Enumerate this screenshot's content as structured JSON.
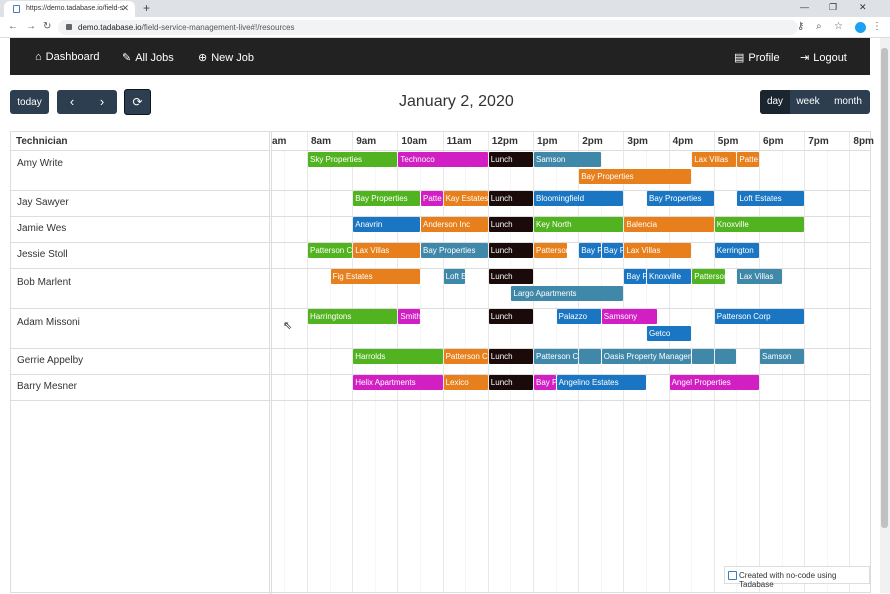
{
  "browser": {
    "tab_title": "https://demo.tadabase.io/field-s",
    "url_host": "demo.tadabase.io",
    "url_path": "/field-service-management-live#!/resources"
  },
  "nav": {
    "dashboard": "Dashboard",
    "all_jobs": "All Jobs",
    "new_job": "New Job",
    "profile": "Profile",
    "logout": "Logout"
  },
  "toolbar": {
    "today": "today",
    "title": "January 2, 2020",
    "views": [
      "day",
      "week",
      "month"
    ],
    "active_view": "day"
  },
  "calendar": {
    "resource_header": "Technician",
    "hours": [
      "am",
      "8am",
      "9am",
      "10am",
      "11am",
      "12pm",
      "1pm",
      "2pm",
      "3pm",
      "4pm",
      "5pm",
      "6pm",
      "7pm",
      "8pm"
    ],
    "technicians": [
      "Amy Write",
      "Jay Sawyer",
      "Jamie Wes",
      "Jessie Stoll",
      "Bob Marlent",
      "Adam Missoni",
      "Gerrie Appelby",
      "Barry Mesner"
    ],
    "events": [
      {
        "row": 0,
        "lane": 0,
        "start": 8.0,
        "end": 10.0,
        "label": "Sky Properties",
        "color": "#52b320"
      },
      {
        "row": 0,
        "lane": 0,
        "start": 10.0,
        "end": 12.0,
        "label": "Technoco",
        "color": "#d21fc4"
      },
      {
        "row": 0,
        "lane": 0,
        "start": 12.0,
        "end": 13.0,
        "label": "Lunch",
        "color": "#1a0a0a"
      },
      {
        "row": 0,
        "lane": 0,
        "start": 13.0,
        "end": 14.5,
        "label": "Samson",
        "color": "#3f88a9"
      },
      {
        "row": 0,
        "lane": 0,
        "start": 16.5,
        "end": 17.5,
        "label": "Lax Villas",
        "color": "#e67f1c"
      },
      {
        "row": 0,
        "lane": 0,
        "start": 17.5,
        "end": 18.0,
        "label": "Patte",
        "color": "#e67f1c"
      },
      {
        "row": 0,
        "lane": 1,
        "start": 14.0,
        "end": 16.5,
        "label": "Bay Properties",
        "color": "#e67f1c"
      },
      {
        "row": 1,
        "lane": 0,
        "start": 9.0,
        "end": 10.5,
        "label": "Bay Properties",
        "color": "#52b320"
      },
      {
        "row": 1,
        "lane": 0,
        "start": 10.5,
        "end": 11.0,
        "label": "Patte",
        "color": "#d21fc4"
      },
      {
        "row": 1,
        "lane": 0,
        "start": 11.0,
        "end": 12.0,
        "label": "Kay Estates",
        "color": "#e67f1c"
      },
      {
        "row": 1,
        "lane": 0,
        "start": 12.0,
        "end": 13.0,
        "label": "Lunch",
        "color": "#1a0a0a"
      },
      {
        "row": 1,
        "lane": 0,
        "start": 13.0,
        "end": 15.0,
        "label": "Bloomingfield",
        "color": "#1a76c2"
      },
      {
        "row": 1,
        "lane": 0,
        "start": 15.5,
        "end": 17.0,
        "label": "Bay Properties",
        "color": "#1a76c2"
      },
      {
        "row": 1,
        "lane": 0,
        "start": 17.5,
        "end": 19.0,
        "label": "Loft Estates",
        "color": "#1a76c2"
      },
      {
        "row": 2,
        "lane": 0,
        "start": 9.0,
        "end": 10.5,
        "label": "Anavrin",
        "color": "#1a76c2"
      },
      {
        "row": 2,
        "lane": 0,
        "start": 10.5,
        "end": 12.0,
        "label": "Anderson Inc",
        "color": "#e67f1c"
      },
      {
        "row": 2,
        "lane": 0,
        "start": 12.0,
        "end": 13.0,
        "label": "Lunch",
        "color": "#1a0a0a"
      },
      {
        "row": 2,
        "lane": 0,
        "start": 13.0,
        "end": 15.0,
        "label": "Key North",
        "color": "#52b320"
      },
      {
        "row": 2,
        "lane": 0,
        "start": 15.0,
        "end": 17.0,
        "label": "Balencia",
        "color": "#e67f1c"
      },
      {
        "row": 2,
        "lane": 0,
        "start": 17.0,
        "end": 19.0,
        "label": "Knoxville",
        "color": "#52b320"
      },
      {
        "row": 3,
        "lane": 0,
        "start": 8.0,
        "end": 9.0,
        "label": "Patterson Corp",
        "color": "#52b320"
      },
      {
        "row": 3,
        "lane": 0,
        "start": 9.0,
        "end": 10.5,
        "label": "Lax Villas",
        "color": "#e67f1c"
      },
      {
        "row": 3,
        "lane": 0,
        "start": 10.5,
        "end": 12.0,
        "label": "Bay Properties",
        "color": "#3f88a9"
      },
      {
        "row": 3,
        "lane": 0,
        "start": 12.0,
        "end": 13.0,
        "label": "Lunch",
        "color": "#1a0a0a"
      },
      {
        "row": 3,
        "lane": 0,
        "start": 13.0,
        "end": 13.75,
        "label": "Patterson",
        "color": "#e67f1c"
      },
      {
        "row": 3,
        "lane": 0,
        "start": 14.0,
        "end": 14.5,
        "label": "Bay Properties",
        "color": "#1a76c2"
      },
      {
        "row": 3,
        "lane": 0,
        "start": 14.5,
        "end": 15.0,
        "label": "Bay Properties",
        "color": "#1a76c2"
      },
      {
        "row": 3,
        "lane": 0,
        "start": 15.0,
        "end": 16.5,
        "label": "Lax Villas",
        "color": "#e67f1c"
      },
      {
        "row": 3,
        "lane": 0,
        "start": 17.0,
        "end": 18.0,
        "label": "Kerrington",
        "color": "#1a76c2"
      },
      {
        "row": 4,
        "lane": 0,
        "start": 8.5,
        "end": 10.5,
        "label": "Fig Estates",
        "color": "#e67f1c"
      },
      {
        "row": 4,
        "lane": 0,
        "start": 11.0,
        "end": 11.5,
        "label": "Loft Estates",
        "color": "#3f88a9"
      },
      {
        "row": 4,
        "lane": 0,
        "start": 12.0,
        "end": 13.0,
        "label": "Lunch",
        "color": "#1a0a0a"
      },
      {
        "row": 4,
        "lane": 0,
        "start": 15.0,
        "end": 15.5,
        "label": "Bay Properties",
        "color": "#1a76c2"
      },
      {
        "row": 4,
        "lane": 0,
        "start": 15.5,
        "end": 16.5,
        "label": "Knoxville",
        "color": "#1a76c2"
      },
      {
        "row": 4,
        "lane": 0,
        "start": 16.5,
        "end": 17.25,
        "label": "Patterson",
        "color": "#52b320"
      },
      {
        "row": 4,
        "lane": 0,
        "start": 17.5,
        "end": 18.5,
        "label": "Lax Villas",
        "color": "#3f88a9"
      },
      {
        "row": 4,
        "lane": 1,
        "start": 12.5,
        "end": 15.0,
        "label": "Largo Apartments",
        "color": "#3f88a9"
      },
      {
        "row": 5,
        "lane": 0,
        "start": 8.0,
        "end": 10.0,
        "label": "Harringtons",
        "color": "#52b320"
      },
      {
        "row": 5,
        "lane": 0,
        "start": 10.0,
        "end": 10.5,
        "label": "Smith",
        "color": "#d21fc4"
      },
      {
        "row": 5,
        "lane": 0,
        "start": 12.0,
        "end": 13.0,
        "label": "Lunch",
        "color": "#1a0a0a"
      },
      {
        "row": 5,
        "lane": 0,
        "start": 13.5,
        "end": 14.5,
        "label": "Palazzo",
        "color": "#1a76c2"
      },
      {
        "row": 5,
        "lane": 0,
        "start": 14.5,
        "end": 15.75,
        "label": "Samsony",
        "color": "#d21fc4"
      },
      {
        "row": 5,
        "lane": 0,
        "start": 17.0,
        "end": 19.0,
        "label": "Patterson Corp",
        "color": "#1a76c2"
      },
      {
        "row": 5,
        "lane": 1,
        "start": 15.5,
        "end": 16.5,
        "label": "Getco",
        "color": "#1a76c2"
      },
      {
        "row": 6,
        "lane": 0,
        "start": 9.0,
        "end": 11.0,
        "label": "Harrolds",
        "color": "#52b320"
      },
      {
        "row": 6,
        "lane": 0,
        "start": 11.0,
        "end": 12.0,
        "label": "Patterson Corp",
        "color": "#e67f1c"
      },
      {
        "row": 6,
        "lane": 0,
        "start": 12.0,
        "end": 13.0,
        "label": "Lunch",
        "color": "#1a0a0a"
      },
      {
        "row": 6,
        "lane": 0,
        "start": 13.0,
        "end": 14.0,
        "label": "Patterson Corp",
        "color": "#3f88a9"
      },
      {
        "row": 6,
        "lane": 0,
        "start": 14.0,
        "end": 14.5,
        "label": "",
        "color": "#3f88a9"
      },
      {
        "row": 6,
        "lane": 0,
        "start": 14.5,
        "end": 16.5,
        "label": "Oasis Property Management",
        "color": "#3f88a9"
      },
      {
        "row": 6,
        "lane": 0,
        "start": 16.5,
        "end": 17.0,
        "label": "",
        "color": "#3f88a9"
      },
      {
        "row": 6,
        "lane": 0,
        "start": 17.0,
        "end": 17.5,
        "label": "",
        "color": "#3f88a9"
      },
      {
        "row": 6,
        "lane": 0,
        "start": 18.0,
        "end": 19.0,
        "label": "Samson",
        "color": "#3f88a9"
      },
      {
        "row": 7,
        "lane": 0,
        "start": 9.0,
        "end": 11.0,
        "label": "Helix Apartments",
        "color": "#d21fc4"
      },
      {
        "row": 7,
        "lane": 0,
        "start": 11.0,
        "end": 12.0,
        "label": "Lexico",
        "color": "#e67f1c"
      },
      {
        "row": 7,
        "lane": 0,
        "start": 12.0,
        "end": 13.0,
        "label": "Lunch",
        "color": "#1a0a0a"
      },
      {
        "row": 7,
        "lane": 0,
        "start": 13.0,
        "end": 13.5,
        "label": "Bay Properties",
        "color": "#d21fc4"
      },
      {
        "row": 7,
        "lane": 0,
        "start": 13.5,
        "end": 15.5,
        "label": "Angelino Estates",
        "color": "#1a76c2"
      },
      {
        "row": 7,
        "lane": 0,
        "start": 16.0,
        "end": 18.0,
        "label": "Angel Properties",
        "color": "#d21fc4"
      }
    ]
  },
  "footer": {
    "badge": "Created with no-code using Tadabase"
  }
}
